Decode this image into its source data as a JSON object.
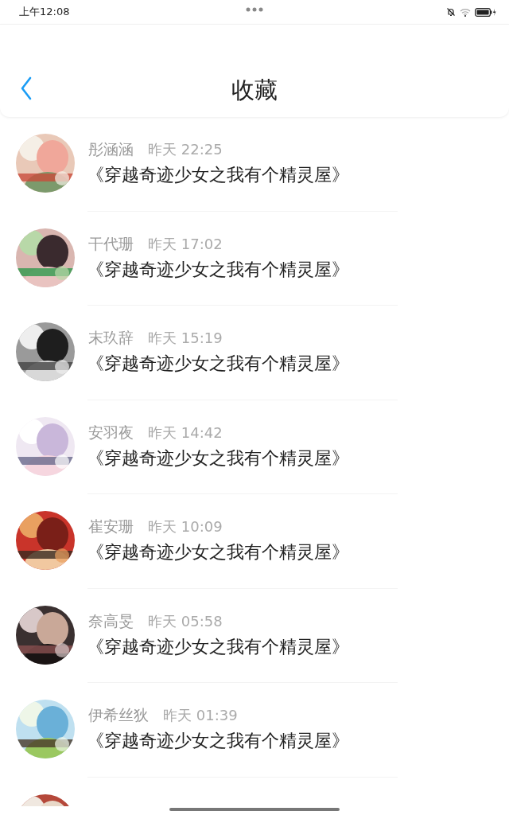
{
  "status_bar": {
    "time": "上午12:08"
  },
  "header": {
    "title": "收藏"
  },
  "items": [
    {
      "name": "彤涵涵",
      "time": "昨天 22:25",
      "book": "《穿越奇迹少女之我有个精灵屋》"
    },
    {
      "name": "干代珊",
      "time": "昨天 17:02",
      "book": "《穿越奇迹少女之我有个精灵屋》"
    },
    {
      "name": "末玖辞",
      "time": "昨天 15:19",
      "book": "《穿越奇迹少女之我有个精灵屋》"
    },
    {
      "name": "安羽夜",
      "time": "昨天 14:42",
      "book": "《穿越奇迹少女之我有个精灵屋》"
    },
    {
      "name": "崔安珊",
      "time": "昨天 10:09",
      "book": "《穿越奇迹少女之我有个精灵屋》"
    },
    {
      "name": "奈高旻",
      "time": "昨天 05:58",
      "book": "《穿越奇迹少女之我有个精灵屋》"
    },
    {
      "name": "伊希丝狄",
      "time": "昨天 01:39",
      "book": "《穿越奇迹少女之我有个精灵屋》"
    },
    {
      "kind": "picture"
    }
  ]
}
